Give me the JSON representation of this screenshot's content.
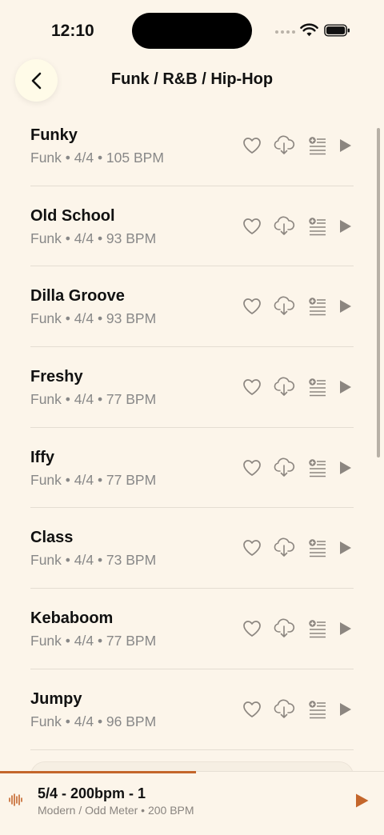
{
  "status": {
    "time": "12:10"
  },
  "header": {
    "title": "Funk / R&B / Hip-Hop"
  },
  "grooves": [
    {
      "name": "Funky",
      "meta": "Funk • 4/4 • 105 BPM"
    },
    {
      "name": "Old School",
      "meta": "Funk • 4/4 • 93 BPM"
    },
    {
      "name": "Dilla Groove",
      "meta": "Funk • 4/4 • 93 BPM"
    },
    {
      "name": "Freshy",
      "meta": "Funk • 4/4 • 77 BPM"
    },
    {
      "name": "Iffy",
      "meta": "Funk • 4/4 • 77 BPM"
    },
    {
      "name": "Class",
      "meta": "Funk • 4/4 • 73 BPM"
    },
    {
      "name": "Kebaboom",
      "meta": "Funk • 4/4 • 77 BPM"
    },
    {
      "name": "Jumpy",
      "meta": "Funk • 4/4 • 96 BPM"
    }
  ],
  "player": {
    "title": "5/4 - 200bpm - 1",
    "subtitle": "Modern / Odd Meter • 200 BPM",
    "progress": 0.51
  },
  "icons": {
    "row_actions": [
      "heart-icon",
      "cloud-download-icon",
      "add-to-queue-icon",
      "play-icon"
    ]
  },
  "colors": {
    "background": "#fcf5ea",
    "accent": "#c4662b",
    "icon": "#8c8680"
  }
}
